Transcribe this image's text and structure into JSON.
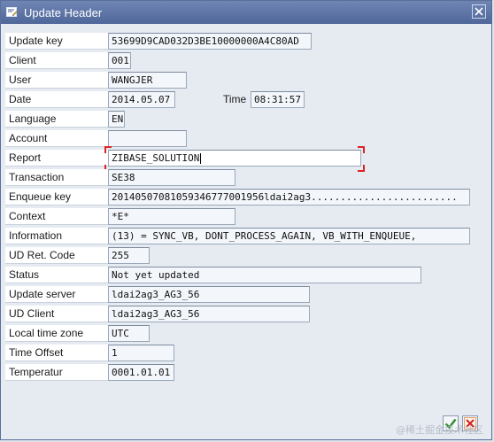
{
  "window": {
    "title": "Update Header"
  },
  "fields": [
    {
      "label": "Update key",
      "value": "53699D9CAD032D3BE10000000A4C80AD"
    },
    {
      "label": "Client",
      "value": "001"
    },
    {
      "label": "User",
      "value": "WANGJER"
    },
    {
      "label": "Date",
      "value": "2014.05.07"
    },
    {
      "label": "Language",
      "value": "EN"
    },
    {
      "label": "Account",
      "value": ""
    },
    {
      "label": "Report",
      "value": "ZIBASE_SOLUTION"
    },
    {
      "label": "Transaction",
      "value": "SE38"
    },
    {
      "label": "Enqueue key",
      "value": "20140507081059346777001956ldai2ag3........................."
    },
    {
      "label": "Context",
      "value": "*E*"
    },
    {
      "label": "Information",
      "value": "(13) =  SYNC_VB, DONT_PROCESS_AGAIN, VB_WITH_ENQUEUE,"
    },
    {
      "label": "UD Ret. Code",
      "value": "255"
    },
    {
      "label": "Status",
      "value": "Not yet updated"
    },
    {
      "label": "Update server",
      "value": "ldai2ag3_AG3_56"
    },
    {
      "label": "UD Client",
      "value": "ldai2ag3_AG3_56"
    },
    {
      "label": "Local time zone",
      "value": "UTC"
    },
    {
      "label": "Time Offset",
      "value": "1"
    },
    {
      "label": "Temperatur",
      "value": "0001.01.01"
    }
  ],
  "time": {
    "label": "Time",
    "value": "08:31:57"
  },
  "footer": {
    "watermark": "@稀土掘金技术社区"
  }
}
